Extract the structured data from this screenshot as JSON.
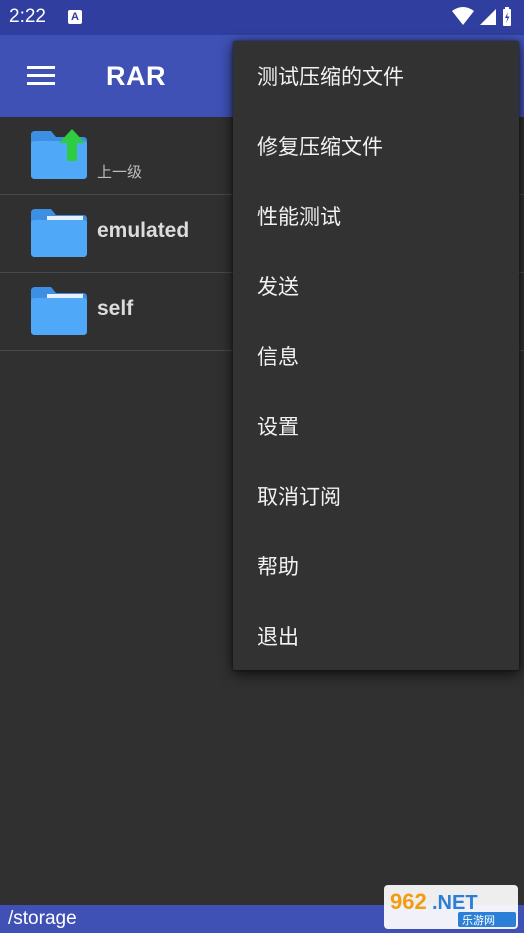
{
  "status_bar": {
    "time": "2:22",
    "notification_icon": "A",
    "icons": [
      "wifi-icon",
      "signal-icon",
      "battery-charging-icon"
    ]
  },
  "app_bar": {
    "title": "RAR",
    "menu_icon": "hamburger-menu-icon"
  },
  "file_list": {
    "parent": {
      "label": "上一级",
      "icon": "folder-up-icon"
    },
    "items": [
      {
        "name": "emulated",
        "icon": "folder-icon"
      },
      {
        "name": "self",
        "icon": "folder-icon"
      }
    ]
  },
  "overflow_menu": {
    "items": [
      {
        "label": "测试压缩的文件"
      },
      {
        "label": "修复压缩文件"
      },
      {
        "label": "性能测试"
      },
      {
        "label": "发送"
      },
      {
        "label": "信息"
      },
      {
        "label": "设置"
      },
      {
        "label": "取消订阅"
      },
      {
        "label": "帮助"
      },
      {
        "label": "退出"
      }
    ]
  },
  "path_bar": {
    "path": "/storage"
  },
  "watermark": {
    "line1": "962.NET",
    "line2": "乐游网"
  },
  "colors": {
    "primary": "#3f51b5",
    "primary_dark": "#303f9f",
    "background": "#303030",
    "folder": "#4fa3f7",
    "up_arrow": "#2ecc40"
  }
}
